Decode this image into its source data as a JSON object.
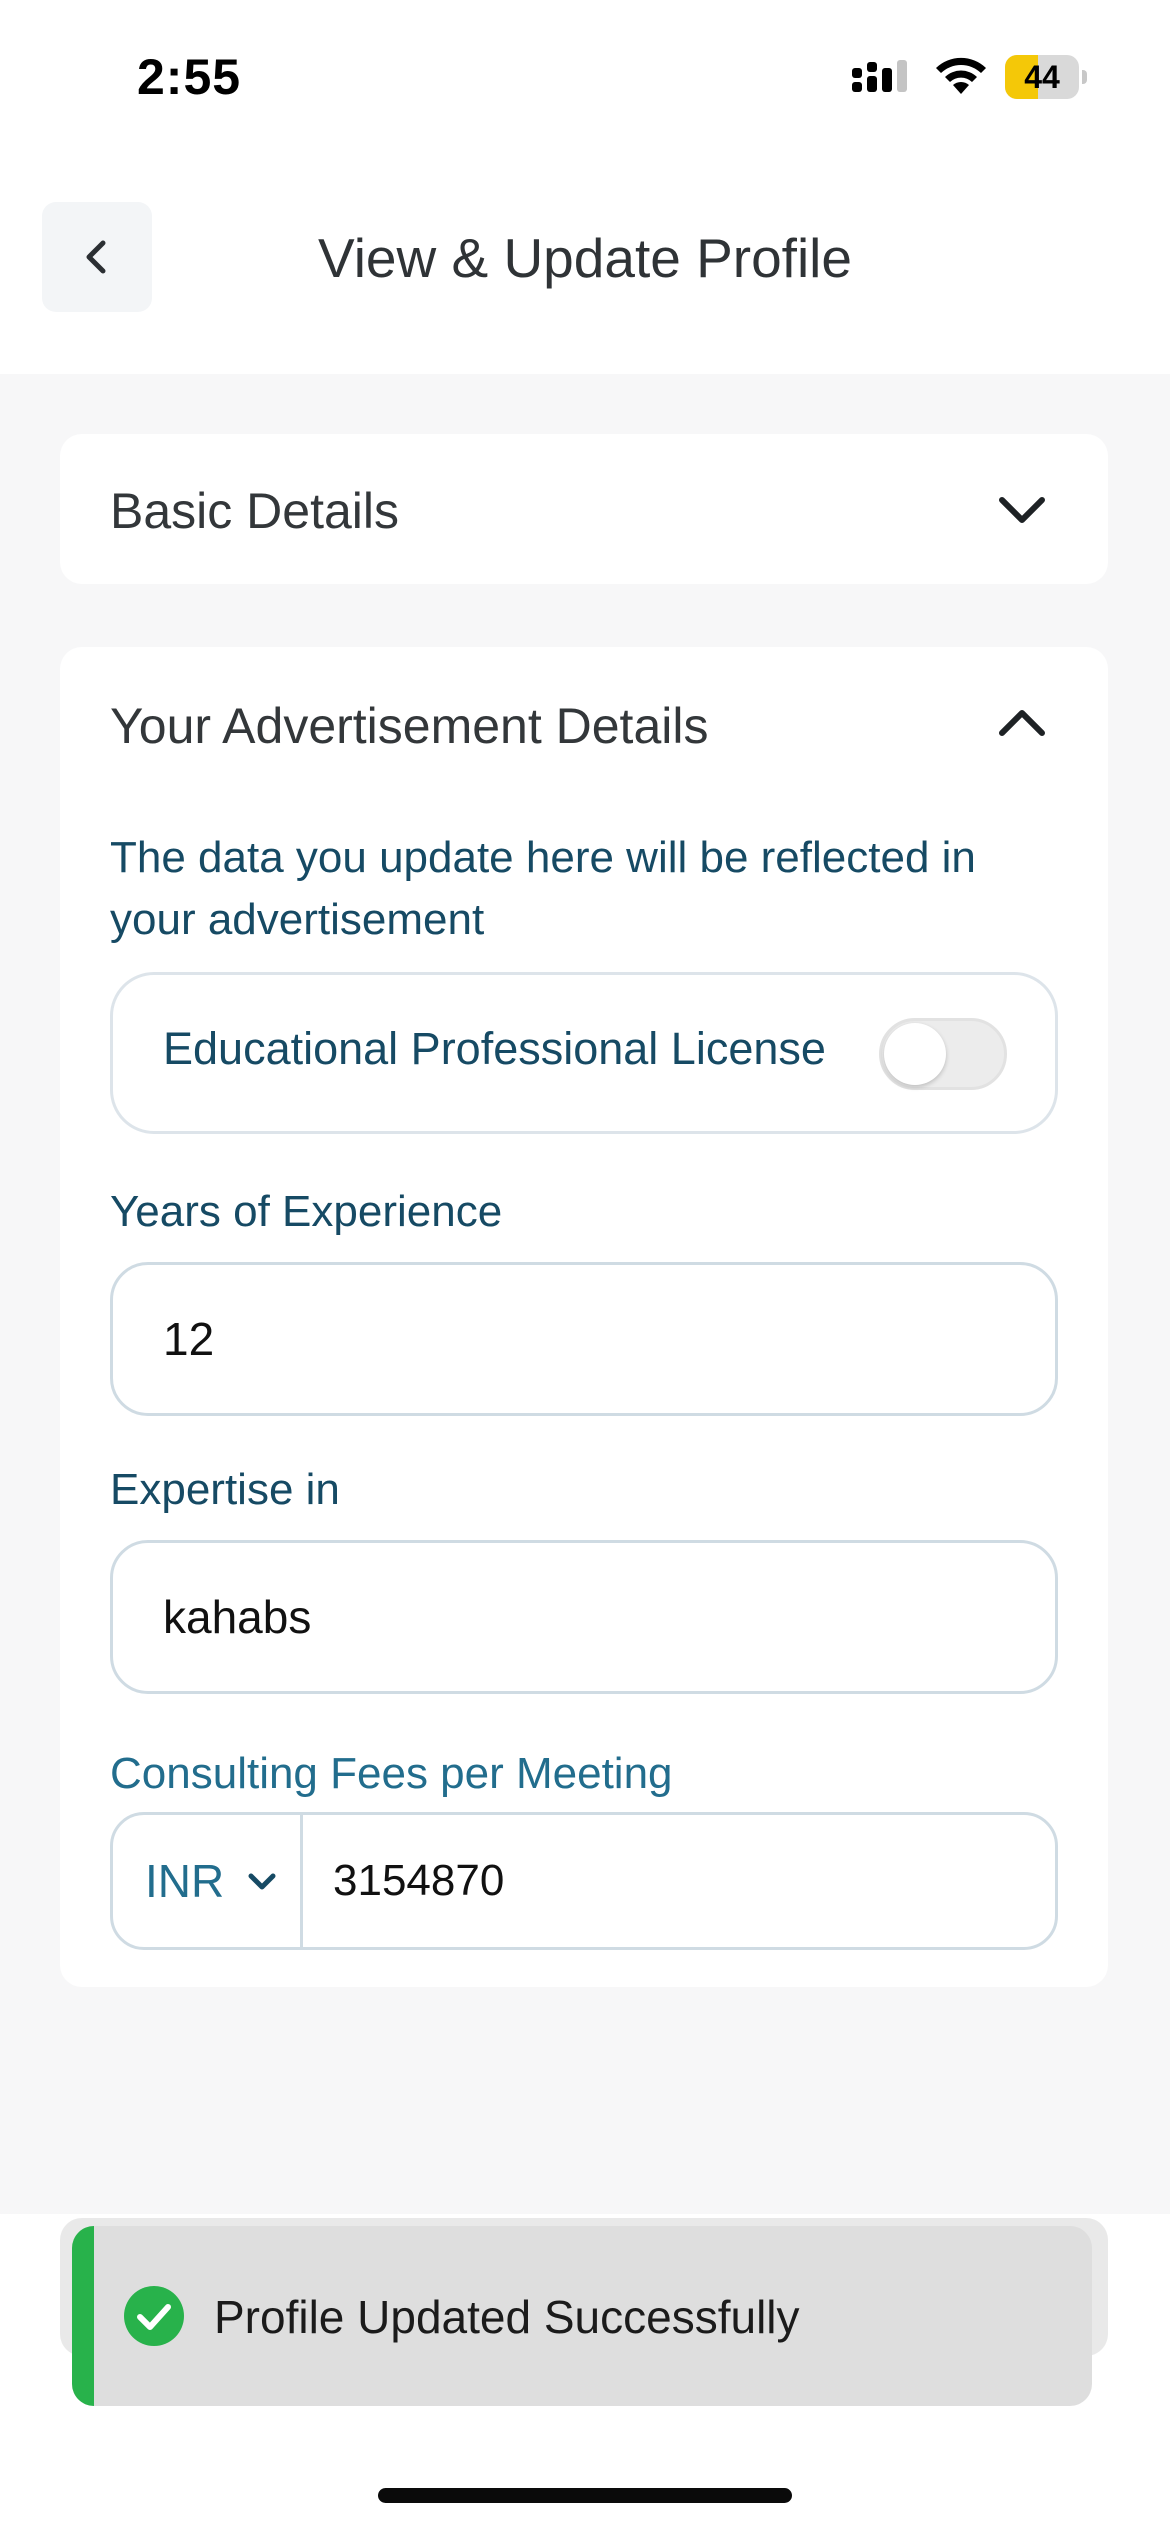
{
  "status_bar": {
    "time": "2:55",
    "battery_level": "44",
    "battery_fraction": 0.44,
    "battery_color": "#f4c808"
  },
  "header": {
    "title": "View & Update Profile",
    "back_icon": "chevron-left-icon"
  },
  "sections": {
    "basic": {
      "title": "Basic Details",
      "expanded": false,
      "icon": "chevron-down-icon"
    },
    "advertisement": {
      "title": "Your Advertisement Details",
      "expanded": true,
      "icon": "chevron-up-icon",
      "info_text": "The data you update here will be reflected in your advertisement",
      "license_toggle": {
        "label": "Educational Professional License",
        "checked": false
      },
      "experience": {
        "label": "Years of Experience",
        "value": "12"
      },
      "expertise": {
        "label": "Expertise in",
        "value": "kahabs"
      },
      "fees": {
        "label": "Consulting Fees per Meeting",
        "currency": "INR",
        "value": "3154870"
      }
    }
  },
  "toast": {
    "message": "Profile Updated Successfully",
    "icon": "check-circle-icon",
    "accent_color": "#28b24b"
  }
}
